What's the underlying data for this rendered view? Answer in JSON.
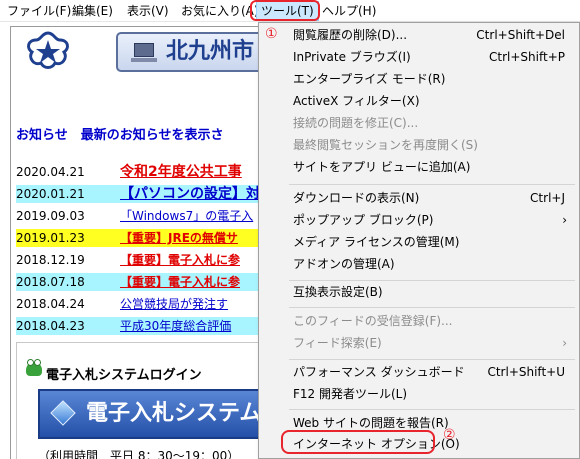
{
  "menubar": {
    "items": [
      {
        "label": "ファイル(F)"
      },
      {
        "label": "編集(E)"
      },
      {
        "label": "表示(V)"
      },
      {
        "label": "お気に入り(A)"
      },
      {
        "label": "ツール(T)"
      },
      {
        "label": "ヘルプ(H)"
      }
    ]
  },
  "page": {
    "site_title": "北九州市",
    "notice_heading": "お知らせ　最新のお知らせを表示さ",
    "news": [
      {
        "date": "2020.04.21",
        "title": "令和2年度公共工事"
      },
      {
        "date": "2020.01.21",
        "title": "【パソコンの設定】対"
      },
      {
        "date": "2019.09.03",
        "title": "「Windows7」の電子入"
      },
      {
        "date": "2019.01.23",
        "title": "【重要】JREの無償サ"
      },
      {
        "date": "2018.12.19",
        "title": "【重要】電子入札に参"
      },
      {
        "date": "2018.07.18",
        "title": "【重要】電子入札に参"
      },
      {
        "date": "2018.04.24",
        "title": "公営競技局が発注す"
      },
      {
        "date": "2018.04.23",
        "title": "平成30年度総合評価"
      }
    ],
    "login_title": "電子入札システムログイン",
    "login_button": "電子入札システム",
    "hours_text": "（利用時間　平日 8：30～19：00）"
  },
  "tools_menu": {
    "items": [
      {
        "label": "閲覧履歴の削除(D)...",
        "shortcut": "Ctrl+Shift+Del"
      },
      {
        "label": "InPrivate ブラウズ(I)",
        "shortcut": "Ctrl+Shift+P"
      },
      {
        "label": "エンタープライズ モード(R)",
        "shortcut": ""
      },
      {
        "label": "ActiveX フィルター(X)",
        "shortcut": ""
      },
      {
        "label": "接続の問題を修正(C)...",
        "shortcut": ""
      },
      {
        "label": "最終閲覧セッションを再度開く(S)",
        "shortcut": ""
      },
      {
        "label": "サイトをアプリ ビューに追加(A)",
        "shortcut": ""
      },
      {
        "label": "ダウンロードの表示(N)",
        "shortcut": "Ctrl+J"
      },
      {
        "label": "ポップアップ ブロック(P)",
        "shortcut": ""
      },
      {
        "label": "メディア ライセンスの管理(M)",
        "shortcut": ""
      },
      {
        "label": "アドオンの管理(A)",
        "shortcut": ""
      },
      {
        "label": "互換表示設定(B)",
        "shortcut": ""
      },
      {
        "label": "このフィードの受信登録(F)...",
        "shortcut": ""
      },
      {
        "label": "フィード探索(E)",
        "shortcut": ""
      },
      {
        "label": "パフォーマンス ダッシュボード",
        "shortcut": "Ctrl+Shift+U"
      },
      {
        "label": "F12 開発者ツール(L)",
        "shortcut": ""
      },
      {
        "label": "Web サイトの問題を報告(R)",
        "shortcut": ""
      },
      {
        "label": "インターネット オプション(O)",
        "shortcut": ""
      }
    ],
    "submenu_arrow": "›"
  },
  "annotations": {
    "marker_1": "①",
    "marker_2": "②"
  },
  "colors": {
    "highlight_ring": "#e8242d",
    "menu_background": "#f2f2f2",
    "active_menu": "#cce8ff",
    "link_blue": "#0000cc",
    "news_red": "#e00000"
  }
}
